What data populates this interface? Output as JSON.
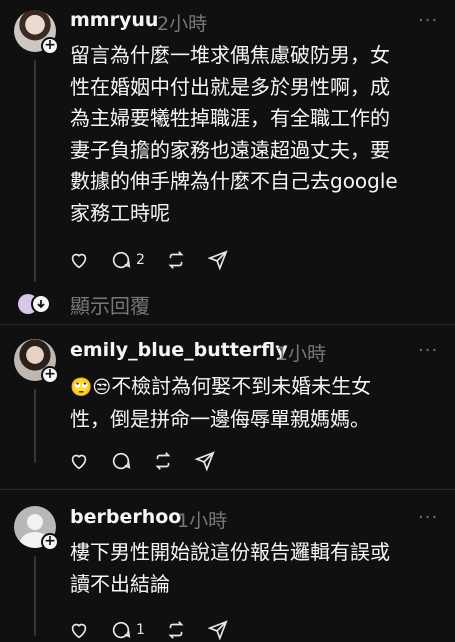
{
  "posts": [
    {
      "username": "mmryuu",
      "time": "2小時",
      "lines": [
        "留言為什麼一堆求偶焦慮破防男，女",
        "性在婚姻中付出就是多於男性啊，成",
        "為主婦要犧牲掉職涯，有全職工作的",
        "妻子負擔的家務也遠遠超過丈夫，要",
        "數據的伸手牌為什麼不自己去google",
        "家務工時呢"
      ],
      "reply_count": "2",
      "show_replies": "顯示回覆"
    },
    {
      "username": "emily_blue_butterfly",
      "time": "1小時",
      "emoji": "🙄😒",
      "lines": [
        "不檢討為何娶不到未婚未生女",
        "性，倒是拼命一邊侮辱單親媽媽。"
      ]
    },
    {
      "username": "berberhoo",
      "time": "1小時",
      "lines": [
        "樓下男性開始說這份報告邏輯有誤或",
        "讀不出結論"
      ],
      "reply_count": "1"
    }
  ],
  "more_label": "···",
  "icons": [
    "heart-icon",
    "comment-icon",
    "repost-icon",
    "share-icon"
  ],
  "colors": {
    "background": "#101010",
    "text": "#f3f5f7",
    "muted": "#777777"
  }
}
